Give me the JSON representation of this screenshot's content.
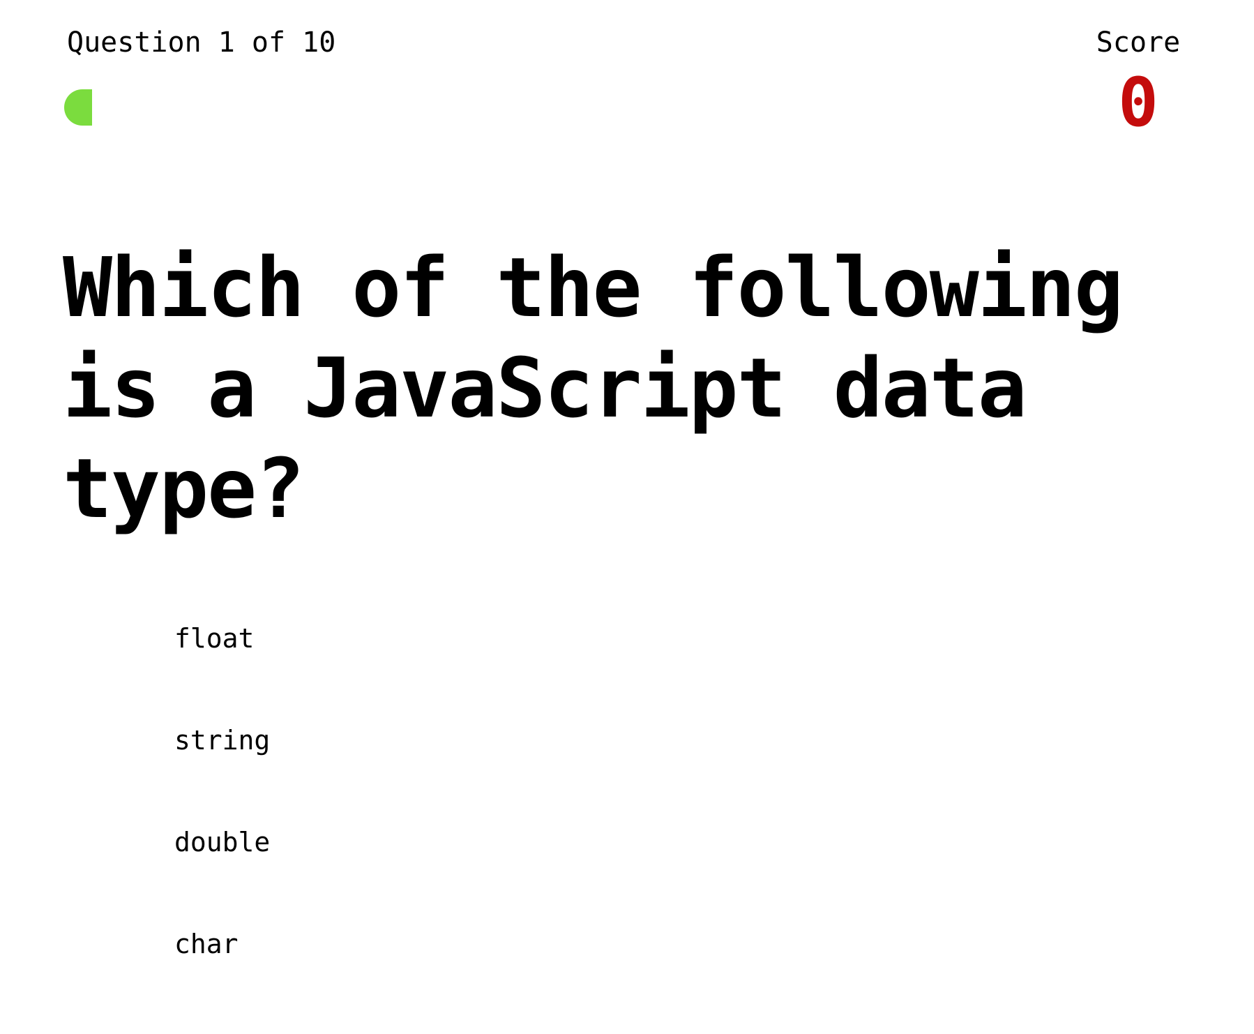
{
  "quiz": {
    "counter": "Question 1 of 10",
    "progress_fraction": 0.1,
    "progress_color": "#7bdc3e",
    "score_label": "Score",
    "score_value": "0",
    "score_color": "#c40c0c"
  },
  "question": {
    "text": "Which of the following is a JavaScript data type?"
  },
  "answers": [
    {
      "label": "float"
    },
    {
      "label": "string"
    },
    {
      "label": "double"
    },
    {
      "label": "char"
    }
  ]
}
